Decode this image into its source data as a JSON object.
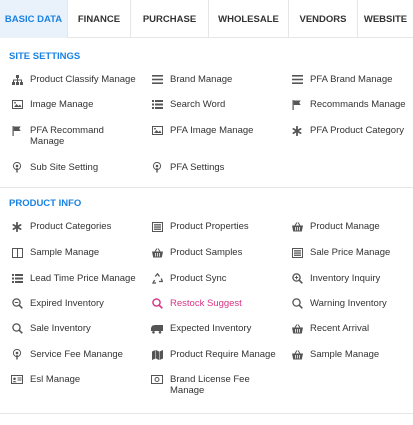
{
  "tabs": [
    {
      "label": "BASIC DATA",
      "active": true
    },
    {
      "label": "FINANCE",
      "active": false
    },
    {
      "label": "PURCHASE",
      "active": false
    },
    {
      "label": "WHOLESALE",
      "active": false
    },
    {
      "label": "VENDORS",
      "active": false
    },
    {
      "label": "WEBSITE",
      "active": false
    }
  ],
  "site_settings": {
    "title": "SITE SETTINGS",
    "items": [
      {
        "label": "Product Classify Manage",
        "icon": "sitemap-icon"
      },
      {
        "label": "Brand Manage",
        "icon": "list-icon"
      },
      {
        "label": "PFA Brand Manage",
        "icon": "list-icon"
      },
      {
        "label": "Image Manage",
        "icon": "image-icon"
      },
      {
        "label": "Search Word",
        "icon": "list-ul-icon"
      },
      {
        "label": "Recommands Manage",
        "icon": "flag-icon"
      },
      {
        "label": "PFA Recommand Manage",
        "icon": "flag-icon"
      },
      {
        "label": "PFA Image Manage",
        "icon": "image-icon"
      },
      {
        "label": "PFA Product Category",
        "icon": "asterisk-icon"
      },
      {
        "label": "Sub Site Setting",
        "icon": "podcast-icon"
      },
      {
        "label": "PFA Settings",
        "icon": "podcast-icon"
      }
    ]
  },
  "product_info": {
    "title": "PRODUCT INFO",
    "items": [
      {
        "label": "Product Categories",
        "icon": "asterisk-icon"
      },
      {
        "label": "Product Properties",
        "icon": "tasks-icon"
      },
      {
        "label": "Product Manage",
        "icon": "basket-icon"
      },
      {
        "label": "Sample Manage",
        "icon": "columns-icon"
      },
      {
        "label": "Product Samples",
        "icon": "basket-icon"
      },
      {
        "label": "Sale Price Manage",
        "icon": "tasks-icon"
      },
      {
        "label": "Lead Time Price Manage",
        "icon": "list-icon"
      },
      {
        "label": "Product Sync",
        "icon": "recycle-icon"
      },
      {
        "label": "Inventory Inquiry",
        "icon": "search-plus-icon"
      },
      {
        "label": "Expired Inventory",
        "icon": "search-minus-icon"
      },
      {
        "label": "Restock Suggest",
        "icon": "search-icon",
        "highlight": true
      },
      {
        "label": "Warning Inventory",
        "icon": "search-icon"
      },
      {
        "label": "Sale Inventory",
        "icon": "search-icon"
      },
      {
        "label": "Expected Inventory",
        "icon": "truck-icon"
      },
      {
        "label": "Recent Arrival",
        "icon": "basket-icon"
      },
      {
        "label": "Service Fee Manange",
        "icon": "podcast-icon"
      },
      {
        "label": "Product Require Manage",
        "icon": "map-icon"
      },
      {
        "label": "Sample Manage",
        "icon": "basket-icon"
      },
      {
        "label": "Esl Manage",
        "icon": "id-card-icon"
      },
      {
        "label": "Brand License Fee Manage",
        "icon": "money-icon"
      }
    ]
  },
  "colors": {
    "accent": "#1a82e2",
    "active_tab_bg": "#e9f1fb",
    "highlight": "#d63384"
  }
}
